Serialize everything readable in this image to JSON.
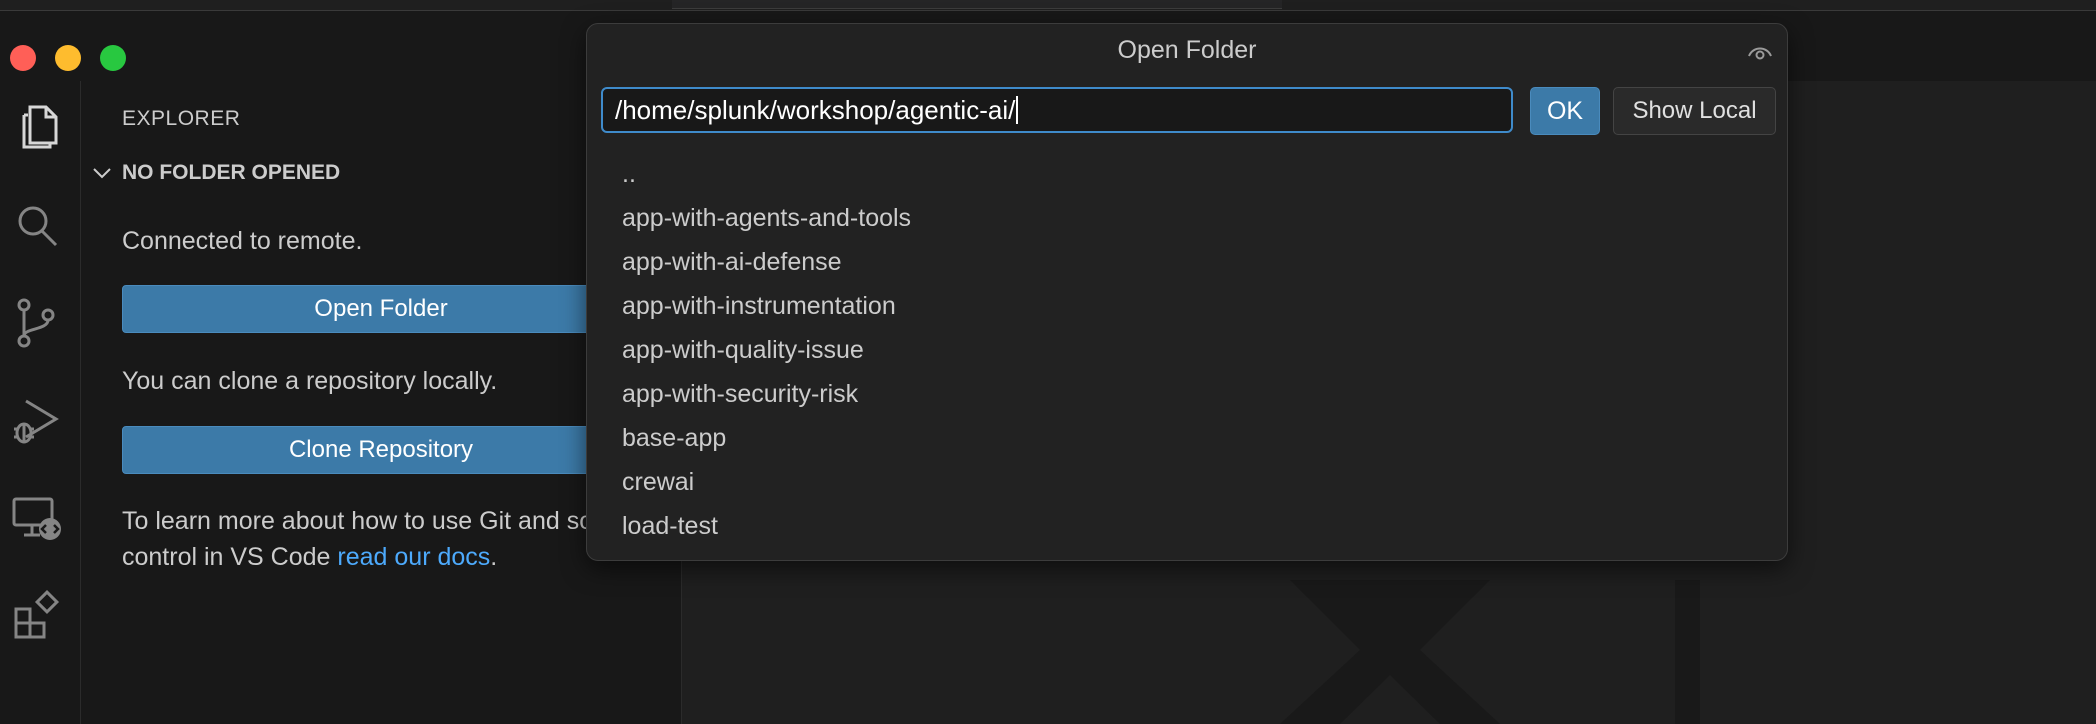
{
  "sidebar": {
    "title": "EXPLORER",
    "section": "NO FOLDER OPENED",
    "connected_text": "Connected to remote.",
    "open_folder_label": "Open Folder",
    "clone_text": "You can clone a repository locally.",
    "clone_label": "Clone Repository",
    "learn_text": "To learn more about how to use Git and source control in VS Code ",
    "learn_link": "read our docs",
    "learn_end": "."
  },
  "activity_icons": [
    "files-icon",
    "search-icon",
    "source-control-icon",
    "run-debug-icon",
    "remote-explorer-icon",
    "extensions-icon"
  ],
  "quickpick": {
    "title": "Open Folder",
    "path_value": "/home/splunk/workshop/agentic-ai/",
    "ok_label": "OK",
    "show_local_label": "Show Local",
    "items": [
      "..",
      "app-with-agents-and-tools",
      "app-with-ai-defense",
      "app-with-instrumentation",
      "app-with-quality-issue",
      "app-with-security-risk",
      "base-app",
      "crewai",
      "load-test"
    ]
  },
  "colors": {
    "accent": "#3f8bcb",
    "button": "#3c7aa8",
    "link": "#4daafc",
    "background": "#1f1f1f"
  }
}
